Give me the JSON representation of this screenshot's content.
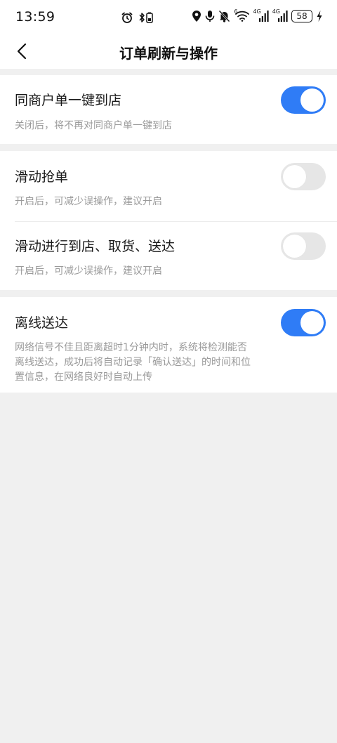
{
  "status_bar": {
    "time": "13:59",
    "signal1_label": "4G",
    "signal2_label": "4G",
    "wifi_label": "6",
    "battery": "58",
    "icons": [
      "alarm-icon",
      "bluetooth-battery-icon",
      "location-icon",
      "microphone-icon",
      "bell-off-icon",
      "wifi-icon",
      "cell-signal-icon",
      "cell-signal-icon",
      "battery-icon",
      "charging-icon"
    ]
  },
  "header": {
    "title": "订单刷新与操作",
    "back_icon": "chevron-left-icon"
  },
  "settings": [
    {
      "title": "同商户单一键到店",
      "desc": "关闭后，将不再对同商户单一键到店",
      "enabled": true
    },
    {
      "title": "滑动抢单",
      "desc": "开启后，可减少误操作，建议开启",
      "enabled": false
    },
    {
      "title": "滑动进行到店、取货、送达",
      "desc": "开启后，可减少误操作，建议开启",
      "enabled": false
    },
    {
      "title": "离线送达",
      "desc_lines": [
        "网络信号不佳且距离超时1分钟内时，系统将检测能否",
        "离线送达，成功后将自动记录「确认送达」的时间和位",
        "置信息，在网络良好时自动上传"
      ],
      "enabled": true
    }
  ],
  "colors": {
    "toggle_on": "#2f7cf6",
    "toggle_off": "#e6e6e6",
    "page_background": "#f0f0f0",
    "card_background": "#ffffff",
    "description_text": "#9a9a9a"
  }
}
